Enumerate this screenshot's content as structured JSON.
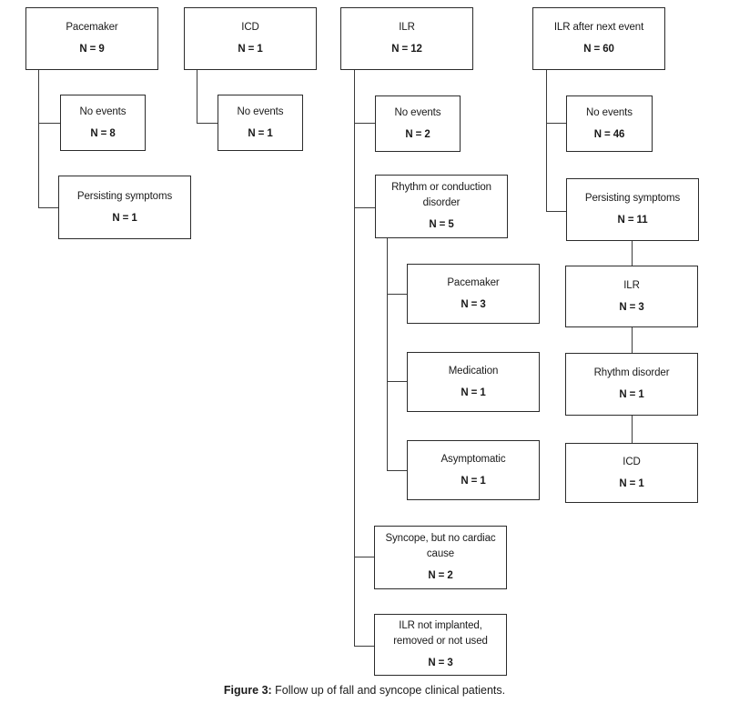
{
  "figure": {
    "caption_prefix": "Figure 3:",
    "caption_text": " Follow up of fall and syncope clinical patients.",
    "line_color": "#3b3b3b",
    "box_border_color": "#2b2b2b",
    "background_color": "#ffffff",
    "text_color": "#1a1a1a"
  },
  "columns": [
    {
      "id": "pacemaker-column",
      "root": {
        "label": "Pacemaker",
        "count": "N = 9"
      },
      "children": [
        {
          "label": "No events",
          "count": "N = 8"
        },
        {
          "label": "Persisting symptoms",
          "count": "N = 1"
        }
      ]
    },
    {
      "id": "icd-column",
      "root": {
        "label": "ICD",
        "count": "N = 1"
      },
      "children": [
        {
          "label": "No events",
          "count": "N = 1"
        }
      ]
    },
    {
      "id": "ilr-column",
      "root": {
        "label": "ILR",
        "count": "N = 12"
      },
      "children": [
        {
          "label": "No events",
          "count": "N = 2"
        },
        {
          "label": "Rhythm or conduction disorder",
          "count": "N = 5"
        },
        {
          "label": "Syncope, but no cardiac cause",
          "count": "N = 2"
        },
        {
          "label": "ILR not implanted, removed or not used",
          "count": "N = 3"
        }
      ],
      "grandchildren": [
        {
          "label": "Pacemaker",
          "count": "N = 3"
        },
        {
          "label": "Medication",
          "count": "N = 1"
        },
        {
          "label": "Asymptomatic",
          "count": "N = 1"
        }
      ]
    },
    {
      "id": "ilr-after-next-event-column",
      "root": {
        "label": "ILR after next event",
        "count": "N = 60"
      },
      "children": [
        {
          "label": "No events",
          "count": "N = 46"
        },
        {
          "label": "Persisting symptoms",
          "count": "N = 11"
        }
      ],
      "chain": [
        {
          "label": "ILR",
          "count": "N = 3"
        },
        {
          "label": "Rhythm disorder",
          "count": "N = 1"
        },
        {
          "label": "ICD",
          "count": "N = 1"
        }
      ]
    }
  ]
}
